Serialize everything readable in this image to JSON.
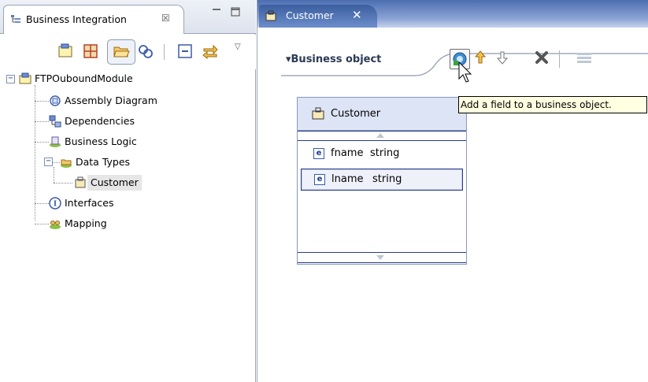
{
  "left_view": {
    "title": "Business Integration",
    "close_glyph": "☒",
    "tree": {
      "module": "FTPOuboundModule",
      "items": [
        {
          "label": "Assembly Diagram",
          "icon": "assembly-diagram-icon"
        },
        {
          "label": "Dependencies",
          "icon": "dependencies-icon"
        },
        {
          "label": "Business Logic",
          "icon": "business-logic-icon"
        },
        {
          "label": "Data Types",
          "icon": "data-types-icon"
        },
        {
          "label": "Interfaces",
          "icon": "interfaces-icon"
        },
        {
          "label": "Mapping",
          "icon": "mapping-icon"
        }
      ],
      "data_types_child": "Customer"
    }
  },
  "editor": {
    "tab_title": "Customer",
    "tab_close": "✕",
    "section_title": "▾Business object",
    "tooltip": "Add a field to a business object.",
    "business_object": {
      "name": "Customer",
      "fields": [
        {
          "name": "fname",
          "type": "string",
          "icon_letter": "e"
        },
        {
          "name": "lname",
          "type": "string",
          "icon_letter": "e"
        }
      ]
    }
  },
  "colors": {
    "editor_tab_bg": "#4c6eb0",
    "bo_header_bg": "#dde4f5",
    "tooltip_bg": "#ffffe1",
    "selection_border": "#2a3a8a"
  }
}
